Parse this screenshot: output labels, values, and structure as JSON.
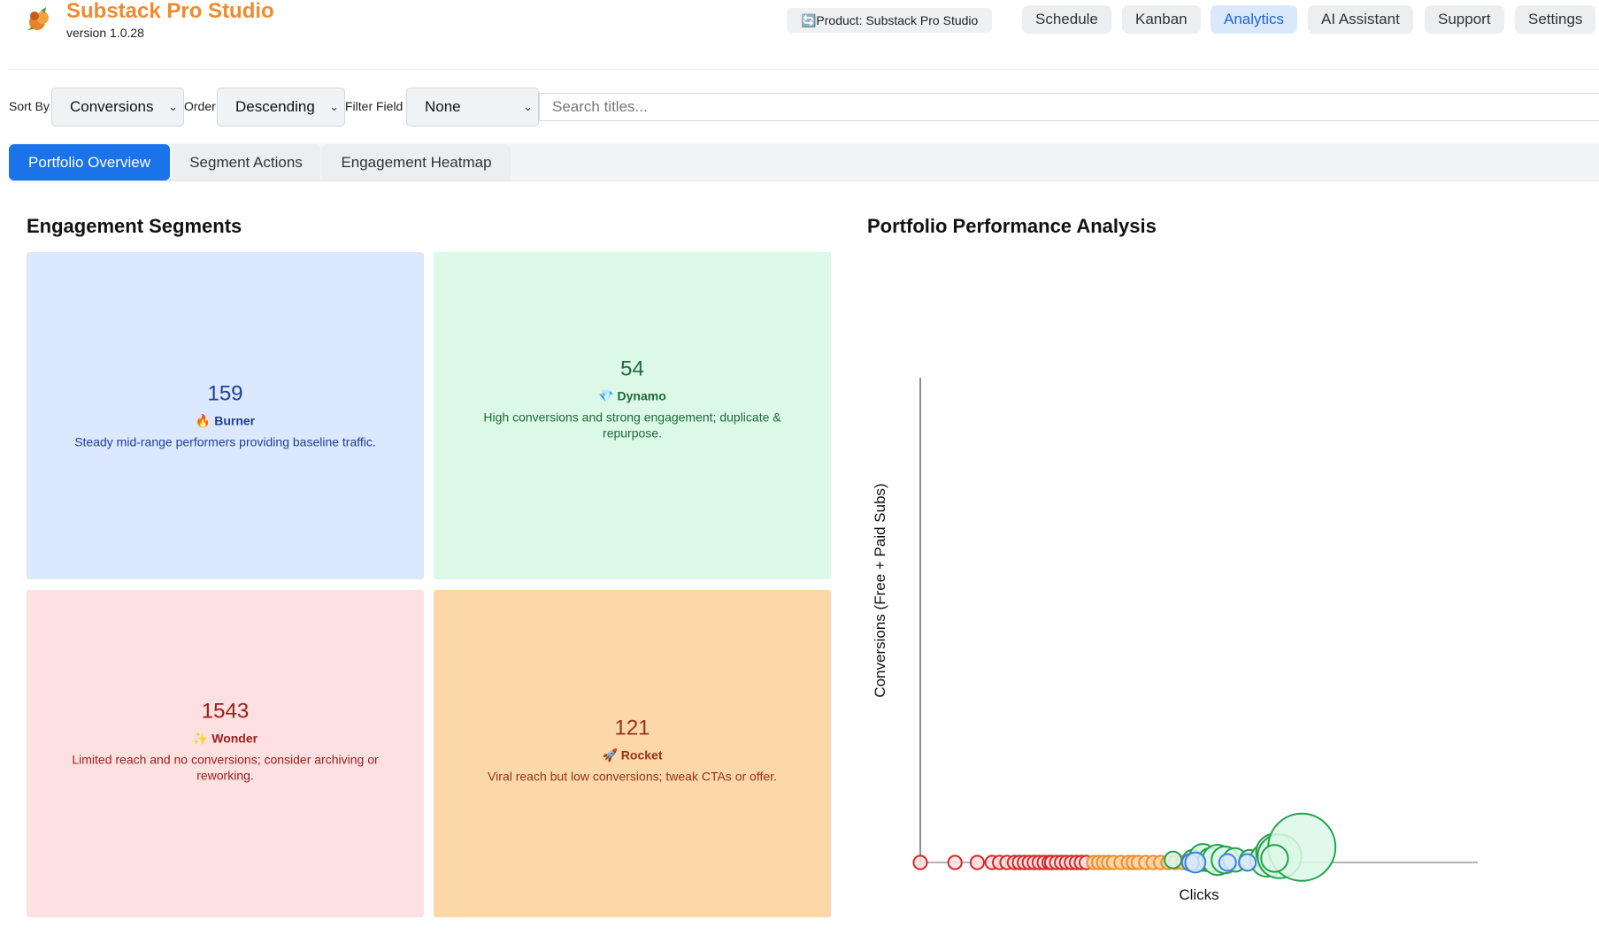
{
  "app": {
    "title": "Substack Pro Studio",
    "version": "version 1.0.28",
    "product_label": "🔄Product: Substack Pro Studio",
    "brand_color": "#f28a2b"
  },
  "nav": [
    {
      "label": "Schedule"
    },
    {
      "label": "Kanban"
    },
    {
      "label": "Analytics",
      "active": true
    },
    {
      "label": "AI Assistant"
    },
    {
      "label": "Support"
    },
    {
      "label": "Settings"
    }
  ],
  "controls": {
    "sort_by_label": "Sort By",
    "sort_by_value": "Conversions",
    "order_label": "Order",
    "order_value": "Descending",
    "filter_label": "Filter Field",
    "filter_value": "None",
    "search_placeholder": "Search titles..."
  },
  "tabs": [
    {
      "label": "Portfolio Overview",
      "active": true
    },
    {
      "label": "Segment Actions"
    },
    {
      "label": "Engagement Heatmap"
    }
  ],
  "segments": {
    "title": "Engagement Segments",
    "items": [
      {
        "count": "159",
        "name": "🔥 Burner",
        "desc": "Steady mid-range performers providing baseline traffic.",
        "color": "#dbe8fd"
      },
      {
        "count": "54",
        "name": "💎 Dynamo",
        "desc": "High conversions and strong engagement; duplicate & repurpose.",
        "color": "#dcf8e6"
      },
      {
        "count": "1543",
        "name": "✨ Wonder",
        "desc": "Limited reach and no conversions; consider archiving or reworking.",
        "color": "#fde0e0"
      },
      {
        "count": "121",
        "name": "🚀 Rocket",
        "desc": "Viral reach but low conversions; tweak CTAs or offer.",
        "color": "#fcd7a8"
      }
    ]
  },
  "chart_data": {
    "type": "scatter",
    "title": "Portfolio Performance Analysis",
    "xlabel": "Clicks",
    "ylabel": "Conversions (Free + Paid Subs)",
    "grid": false,
    "x_ticks_visible": false,
    "y_ticks_visible": false,
    "xlim": [
      0,
      1
    ],
    "ylim": [
      0,
      1
    ],
    "series": [
      {
        "segment": "Wonder",
        "color": "#d62828",
        "points": [
          [
            0.0,
            0,
            4
          ],
          [
            0.07,
            0,
            4
          ],
          [
            0.115,
            0,
            4
          ],
          [
            0.145,
            0,
            4
          ],
          [
            0.16,
            0,
            4
          ],
          [
            0.175,
            0,
            4
          ],
          [
            0.19,
            0,
            4
          ],
          [
            0.2,
            0,
            4
          ],
          [
            0.21,
            0,
            4
          ],
          [
            0.22,
            0,
            4
          ],
          [
            0.23,
            0,
            4
          ],
          [
            0.24,
            0,
            4
          ],
          [
            0.25,
            0,
            4
          ],
          [
            0.26,
            0,
            4
          ],
          [
            0.265,
            0,
            4
          ],
          [
            0.275,
            0,
            4
          ],
          [
            0.285,
            0,
            4
          ],
          [
            0.295,
            0,
            4
          ],
          [
            0.305,
            0,
            4
          ],
          [
            0.315,
            0,
            4
          ],
          [
            0.325,
            0,
            4
          ],
          [
            0.335,
            0,
            4
          ]
        ]
      },
      {
        "segment": "Rocket",
        "color": "#f08c2a",
        "points": [
          [
            0.35,
            0,
            4
          ],
          [
            0.36,
            0,
            4
          ],
          [
            0.37,
            0,
            4
          ],
          [
            0.38,
            0,
            4
          ],
          [
            0.39,
            0,
            4
          ],
          [
            0.405,
            0,
            4
          ],
          [
            0.42,
            0,
            4
          ],
          [
            0.43,
            0,
            4
          ],
          [
            0.44,
            0,
            4
          ],
          [
            0.455,
            0,
            4
          ],
          [
            0.47,
            0,
            4
          ],
          [
            0.485,
            0,
            4
          ],
          [
            0.5,
            0,
            4
          ],
          [
            0.515,
            0,
            4
          ],
          [
            0.53,
            0,
            4
          ],
          [
            0.545,
            0,
            4
          ]
        ]
      },
      {
        "segment": "Dynamo",
        "color": "#22a04b",
        "points": [
          [
            0.51,
            0.005,
            5
          ],
          [
            0.55,
            0.005,
            6
          ],
          [
            0.57,
            0.01,
            8
          ],
          [
            0.585,
            0.005,
            7
          ],
          [
            0.6,
            0.005,
            9
          ],
          [
            0.615,
            0.005,
            8
          ],
          [
            0.635,
            0.005,
            7
          ],
          [
            0.665,
            0.005,
            6
          ],
          [
            0.7,
            0.005,
            10
          ],
          [
            0.715,
            0.02,
            11
          ],
          [
            0.725,
            0.012,
            13
          ],
          [
            0.77,
            0.03,
            20
          ],
          [
            0.715,
            0.008,
            8
          ]
        ]
      },
      {
        "segment": "Burner",
        "color": "#3b7fe0",
        "points": [
          [
            0.545,
            0,
            5
          ],
          [
            0.555,
            0,
            6
          ],
          [
            0.62,
            0,
            5
          ],
          [
            0.66,
            0,
            5
          ]
        ]
      }
    ]
  }
}
